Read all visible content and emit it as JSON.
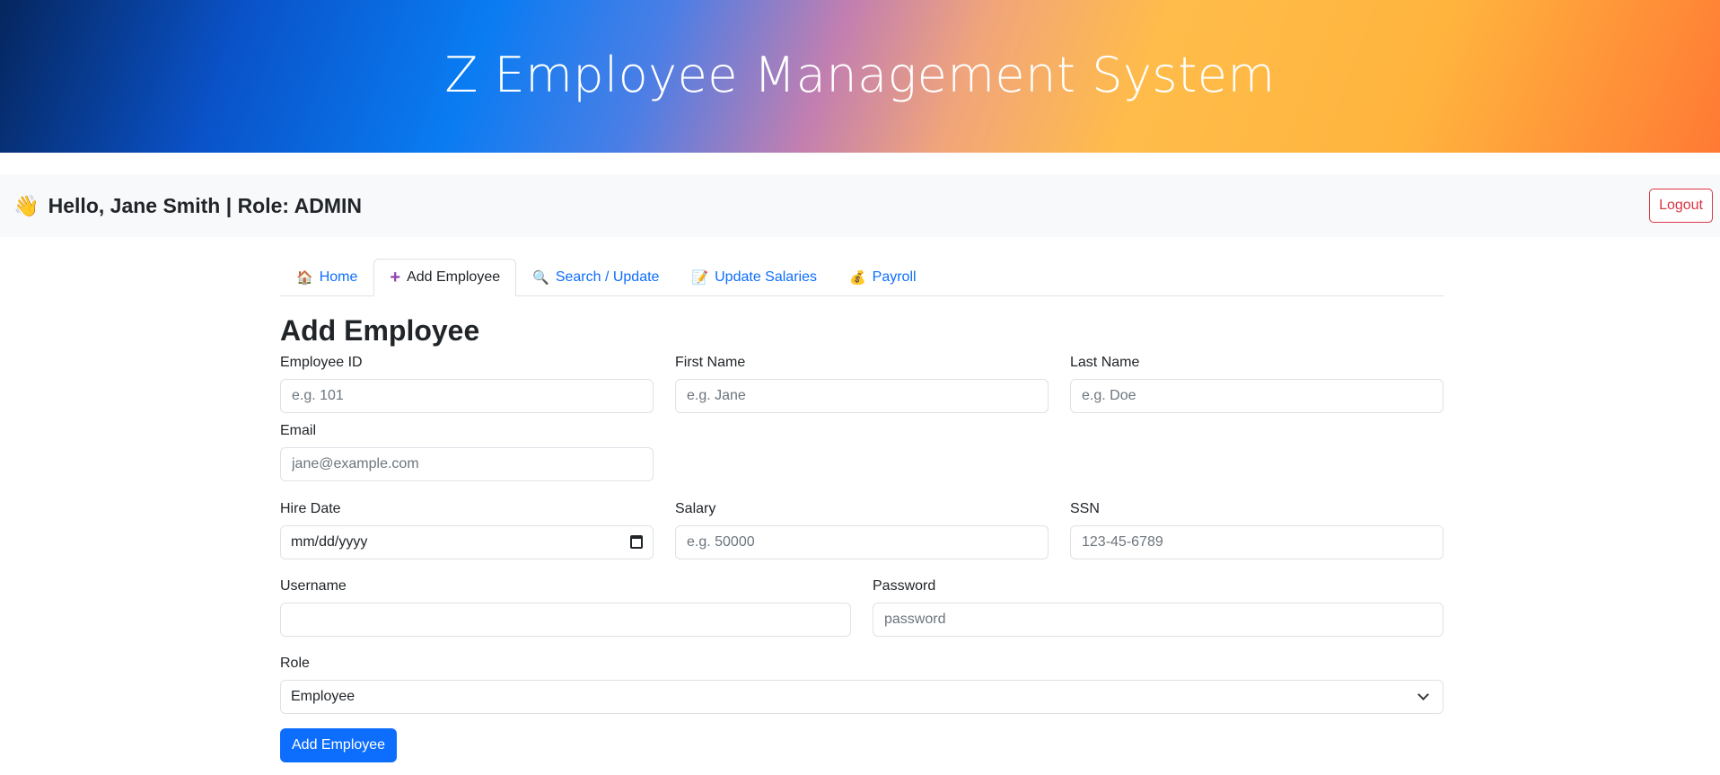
{
  "header": {
    "title": "Z Employee Management System"
  },
  "greeting": {
    "wave": "👋",
    "text": "Hello, Jane Smith | Role: ADMIN"
  },
  "logout_label": "Logout",
  "tabs": [
    {
      "icon": "🏠",
      "label": "Home",
      "active": false
    },
    {
      "icon": "➕",
      "label": "Add Employee",
      "active": true
    },
    {
      "icon": "🔍",
      "label": "Search / Update",
      "active": false
    },
    {
      "icon": "📝",
      "label": "Update Salaries",
      "active": false
    },
    {
      "icon": "💰",
      "label": "Payroll",
      "active": false
    }
  ],
  "form": {
    "title": "Add Employee",
    "employee_id": {
      "label": "Employee ID",
      "placeholder": "e.g. 101"
    },
    "first_name": {
      "label": "First Name",
      "placeholder": "e.g. Jane"
    },
    "last_name": {
      "label": "Last Name",
      "placeholder": "e.g. Doe"
    },
    "email": {
      "label": "Email",
      "placeholder": "jane@example.com"
    },
    "hire_date": {
      "label": "Hire Date",
      "value": "mm/dd/yyyy"
    },
    "salary": {
      "label": "Salary",
      "placeholder": "e.g. 50000"
    },
    "ssn": {
      "label": "SSN",
      "placeholder": "123-45-6789"
    },
    "username": {
      "label": "Username",
      "placeholder": ""
    },
    "password": {
      "label": "Password",
      "placeholder": "password"
    },
    "role": {
      "label": "Role",
      "value": "Employee"
    },
    "submit_label": "Add Employee"
  }
}
